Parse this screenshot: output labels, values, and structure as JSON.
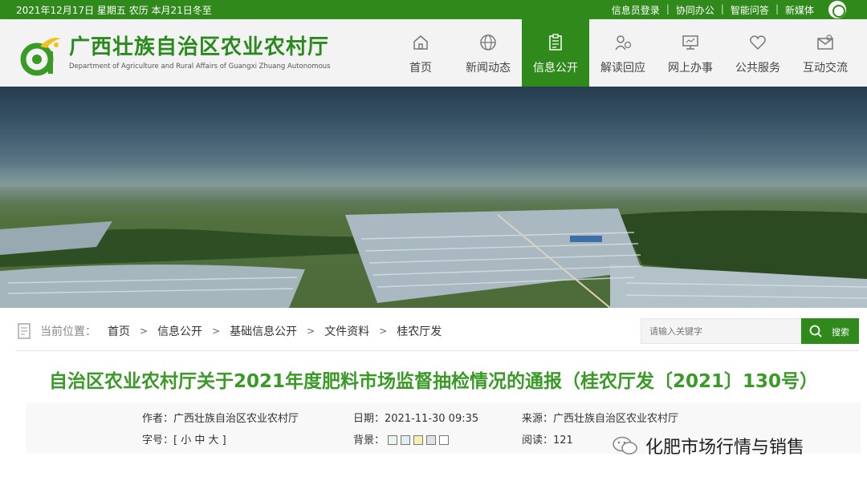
{
  "topbar": {
    "date_text": "2021年12月17日 星期五 农历 本月21日冬至",
    "links": [
      "信息员登录",
      "协同办公",
      "智能问答",
      "新媒体"
    ]
  },
  "header": {
    "title": "广西壮族自治区农业农村厅",
    "subtitle": "Department of Agriculture and Rural Affairs of Guangxi Zhuang Autonomous",
    "nav": [
      {
        "label": "首页",
        "icon": "home-icon"
      },
      {
        "label": "新闻动态",
        "icon": "globe-icon"
      },
      {
        "label": "信息公开",
        "icon": "clipboard-icon",
        "active": true
      },
      {
        "label": "解读回应",
        "icon": "person-chat-icon"
      },
      {
        "label": "网上办事",
        "icon": "monitor-icon"
      },
      {
        "label": "公共服务",
        "icon": "heart-icon"
      },
      {
        "label": "互动交流",
        "icon": "mail-icon"
      }
    ]
  },
  "breadcrumb": {
    "prefix": "当前位置：",
    "items": [
      "首页",
      "信息公开",
      "基础信息公开",
      "文件资料",
      "桂农厅发"
    ]
  },
  "search": {
    "placeholder": "请输入关键字",
    "button_label": "搜索"
  },
  "article": {
    "title": "自治区农业农村厅关于2021年度肥料市场监督抽检情况的通报（桂农厅发〔2021〕130号）",
    "author": "作者：广西壮族自治区农业农村厅",
    "date": "日期：2021-11-30 09:35",
    "source": "来源：广西壮族自治区农业农村厅",
    "font_size": "字号：[ 小  中  大 ]",
    "background_label": "背景：",
    "background_swatches": [
      "#e8f4ec",
      "#dfeef0",
      "#f6f0b0",
      "#e2e2e2",
      "#ffffff"
    ],
    "reads": "阅读：121"
  },
  "watermark": {
    "text": "化肥市场行情与销售"
  },
  "colors": {
    "brand_green": "#2f8a1b",
    "title_green": "#3a9a26"
  }
}
